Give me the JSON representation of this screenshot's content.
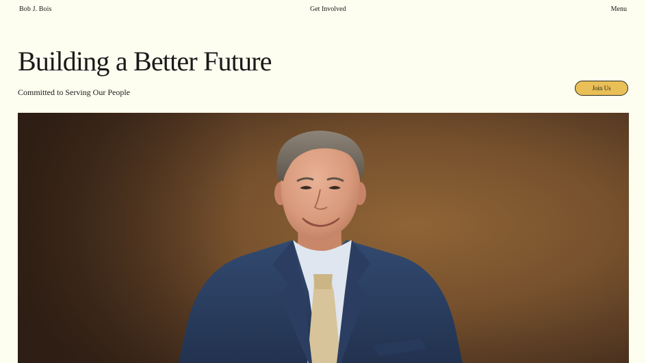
{
  "header": {
    "brand": "Bob J. Bois",
    "nav_center": "Get Involved",
    "menu": "Menu"
  },
  "hero": {
    "title": "Building a Better Future",
    "subtitle": "Committed to Serving Our People",
    "cta_label": "Join Us"
  },
  "colors": {
    "page_background": "#fdfdf0",
    "cta_background": "#e9bf57",
    "text": "#1a1a1a",
    "suit": "#2b3e62",
    "tie": "#d8c49a"
  }
}
